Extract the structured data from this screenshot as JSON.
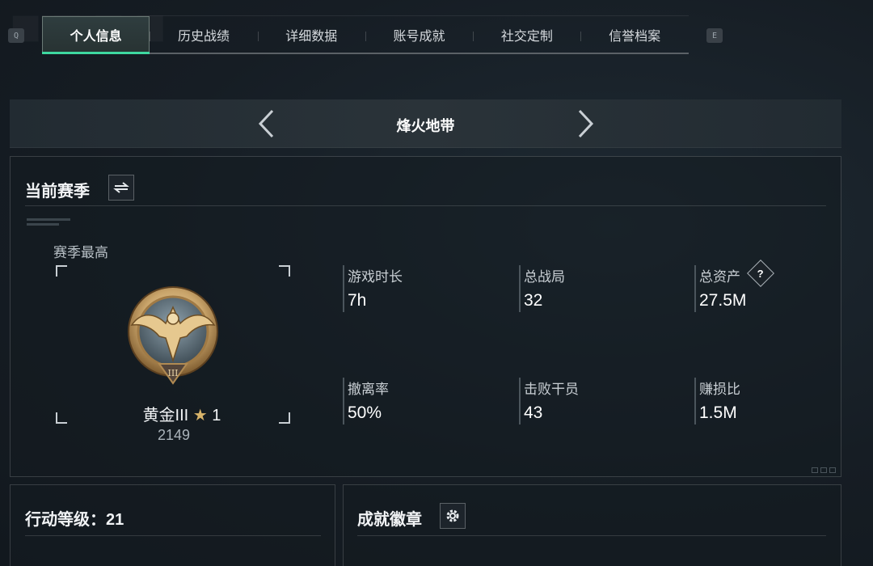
{
  "tabs": [
    {
      "label": "个人信息",
      "active": true
    },
    {
      "label": "历史战绩",
      "active": false
    },
    {
      "label": "详细数据",
      "active": false
    },
    {
      "label": "账号成就",
      "active": false
    },
    {
      "label": "社交定制",
      "active": false
    },
    {
      "label": "信誉档案",
      "active": false
    }
  ],
  "keys": {
    "prev": "Q",
    "next": "E"
  },
  "mode": {
    "title": "烽火地带"
  },
  "season": {
    "title": "当前赛季",
    "best_label": "赛季最高",
    "rank_name": "黄金III",
    "rank_stars": "1",
    "rank_score": "2149",
    "stats": [
      {
        "label": "游戏时长",
        "value": "7h"
      },
      {
        "label": "总战局",
        "value": "32"
      },
      {
        "label": "总资产",
        "value": "27.5M",
        "help": "?"
      },
      {
        "label": "撤离率",
        "value": "50%"
      },
      {
        "label": "击败干员",
        "value": "43"
      },
      {
        "label": "赚损比",
        "value": "1.5M"
      }
    ]
  },
  "level": {
    "title": "行动等级：21"
  },
  "badges": {
    "title": "成就徽章"
  },
  "colors": {
    "accent": "#3ed8a0",
    "medal": "#c9a46a",
    "background": "#161d24"
  }
}
